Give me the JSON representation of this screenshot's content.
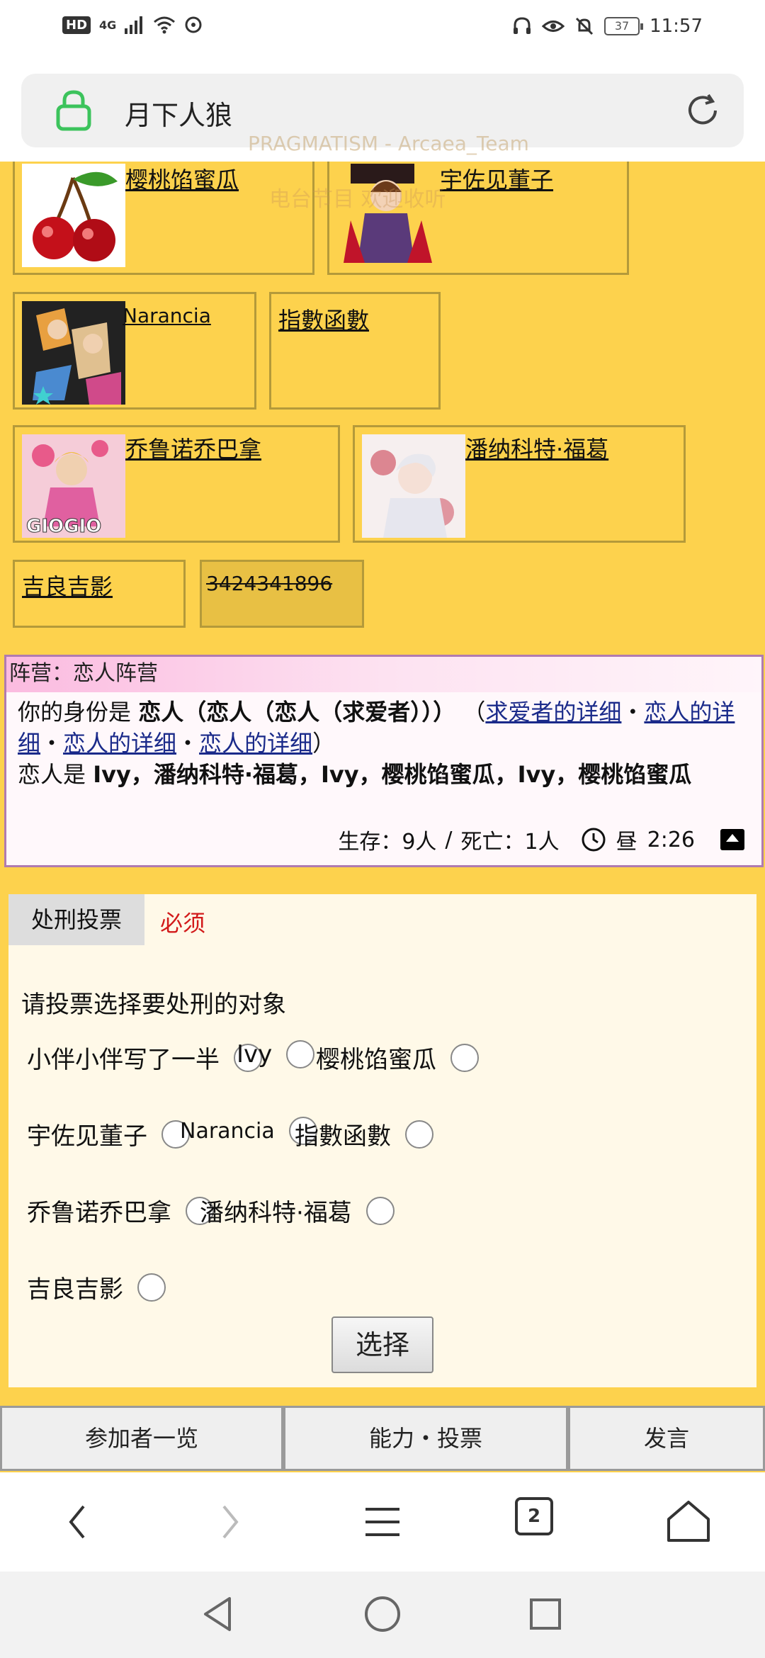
{
  "status_bar": {
    "hd": "HD",
    "network": "4G",
    "battery": "37",
    "time": "11:57"
  },
  "address_bar": {
    "title": "月下人狼"
  },
  "watermarks": {
    "line1": "PRAGMATISM - Arcaea_Team",
    "line2": "电台节目 欢迎收听"
  },
  "players": [
    {
      "name": "樱桃馅蜜瓜",
      "icon": "cherry-avatar"
    },
    {
      "name": "宇佐见董子",
      "icon": "character-avatar"
    },
    {
      "name": "Narancia",
      "icon": "jojo-avatar"
    },
    {
      "name": "指數函數",
      "icon": ""
    },
    {
      "name": "乔鲁诺乔巴拿",
      "icon": "giogio-avatar"
    },
    {
      "name": "潘纳科特·福葛",
      "icon": "white-hair-avatar"
    },
    {
      "name": "吉良吉影",
      "icon": ""
    },
    {
      "name": "3424341896",
      "icon": "",
      "dead": true
    }
  ],
  "role": {
    "camp": "阵营：恋人阵营",
    "identity_prefix": "你的身份是 ",
    "identity": "恋人（恋人（恋人（求爱者）））",
    "paren_open": "（",
    "links": [
      "求爱者的详细",
      "恋人的详细",
      "恋人的详细",
      "恋人的详细"
    ],
    "separator": "・",
    "paren_close": "）",
    "lovers_prefix": "恋人是 ",
    "lovers": "Ivy，潘纳科特·福葛，Ivy，樱桃馅蜜瓜，Ivy，樱桃馅蜜瓜",
    "alive": "生存：9人",
    "slash": "/",
    "dead": "死亡：1人",
    "phase": "昼",
    "phase_time": "2:26"
  },
  "vote": {
    "tab_label": "处刑投票",
    "required": "必须",
    "prompt": "请投票选择要处刑的对象",
    "options": [
      "小伴小伴写了一半",
      "Ivy",
      "樱桃馅蜜瓜",
      "宇佐见董子",
      "Narancia",
      "指數函數",
      "乔鲁诺乔巴拿",
      "潘纳科特·福葛",
      "吉良吉影"
    ],
    "button": "选择"
  },
  "page_tabs": [
    "参加者一览",
    "能力・投票",
    "发言"
  ],
  "browser": {
    "tab_count": "2"
  },
  "colors": {
    "page_bg": "#fdd24d",
    "vote_bg": "#fff9e8",
    "required_red": "#d21a1a",
    "link_blue": "#1a2a8a",
    "lock_green": "#3cc35c"
  }
}
